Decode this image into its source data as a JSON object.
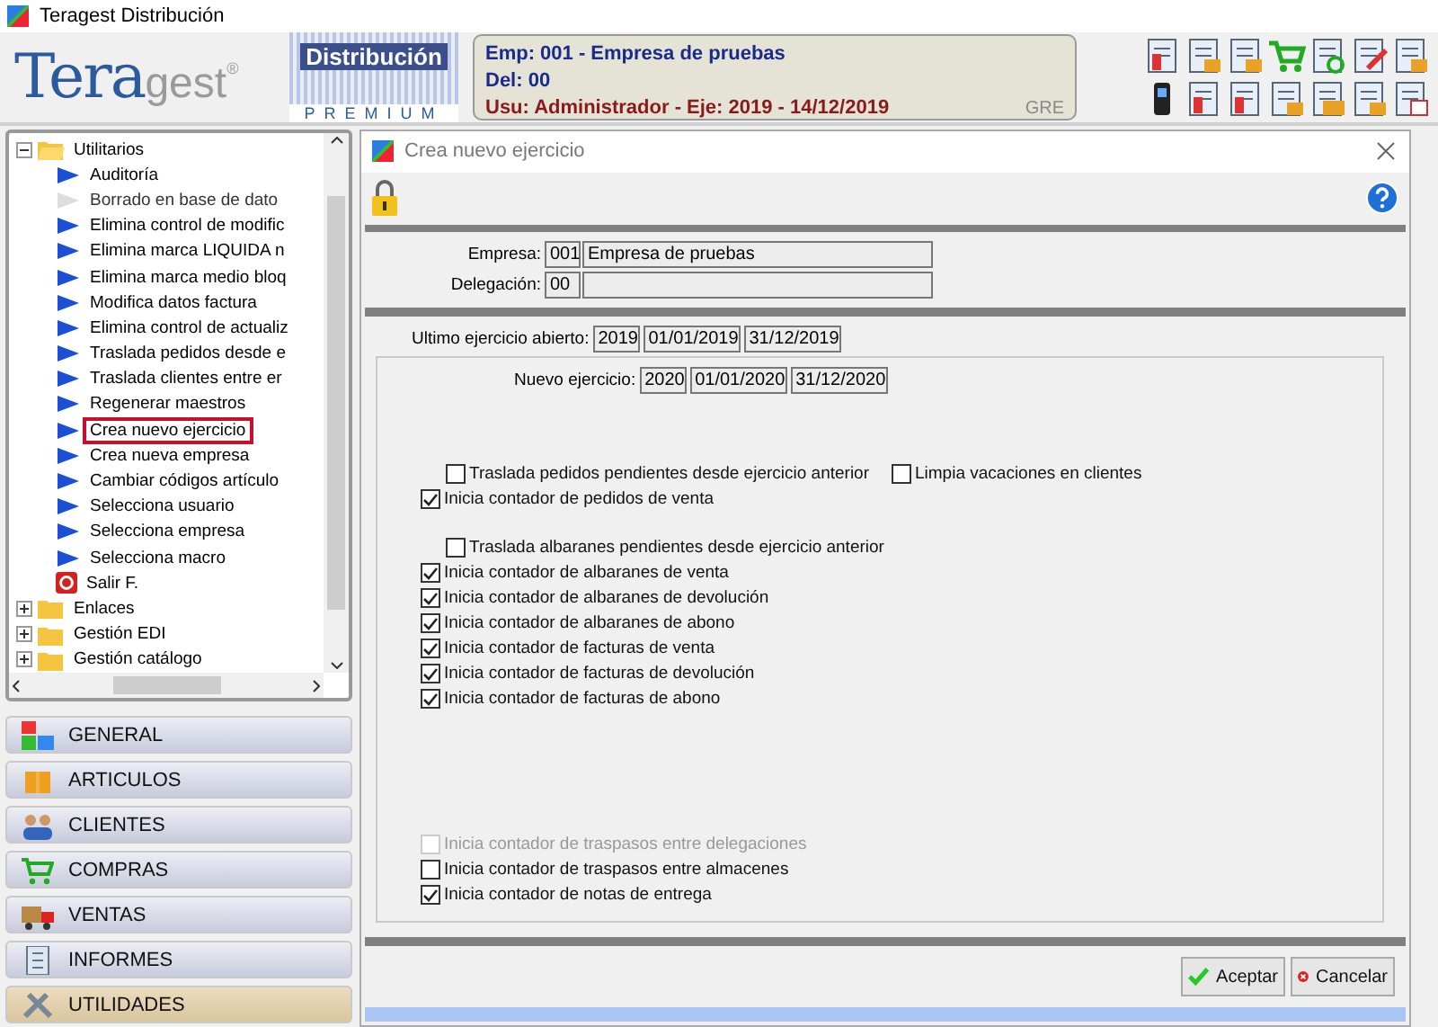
{
  "window": {
    "title": "Teragest Distribución"
  },
  "header": {
    "logo": {
      "part_1": "Tera",
      "part_2": "gest",
      "mark": "®"
    },
    "edition": {
      "name": "Distribución",
      "tier": "PREMIUM"
    },
    "info": {
      "company": "Emp: 001 - Empresa de pruebas",
      "branch": "Del:  00",
      "user": "Usu:  Administrador - Eje: 2019 - 14/12/2019",
      "code": "GRE"
    }
  },
  "tree": {
    "items": [
      {
        "label": "Utilitarios",
        "kind": "folder",
        "expanded": true,
        "children": [
          {
            "label": "Auditoría",
            "kind": "action",
            "disabled": false,
            "selected": false
          },
          {
            "label": "Borrado en base de dato",
            "kind": "action",
            "disabled": true,
            "selected": false
          },
          {
            "label": "Elimina control de modific",
            "kind": "action",
            "disabled": false,
            "selected": false
          },
          {
            "label": "Elimina marca LIQUIDA n",
            "kind": "action",
            "disabled": false,
            "selected": false
          },
          {
            "label": "Elimina marca medio bloq",
            "kind": "action",
            "disabled": false,
            "selected": false
          },
          {
            "label": "Modifica datos factura",
            "kind": "action",
            "disabled": false,
            "selected": false
          },
          {
            "label": "Elimina control de actualiz",
            "kind": "action",
            "disabled": false,
            "selected": false
          },
          {
            "label": "Traslada pedidos desde e",
            "kind": "action",
            "disabled": false,
            "selected": false
          },
          {
            "label": "Traslada clientes entre er",
            "kind": "action",
            "disabled": false,
            "selected": false
          },
          {
            "label": "Regenerar maestros",
            "kind": "action",
            "disabled": false,
            "selected": false
          },
          {
            "label": "Crea nuevo ejercicio",
            "kind": "action",
            "disabled": false,
            "selected": true
          },
          {
            "label": "Crea nueva empresa",
            "kind": "action",
            "disabled": false,
            "selected": false
          },
          {
            "label": "Cambiar códigos artículo",
            "kind": "action",
            "disabled": false,
            "selected": false
          },
          {
            "label": "Selecciona usuario",
            "kind": "action",
            "disabled": false,
            "selected": false
          },
          {
            "label": "Selecciona empresa",
            "kind": "action",
            "disabled": false,
            "selected": false
          },
          {
            "label": "Selecciona macro",
            "kind": "action",
            "disabled": false,
            "selected": false
          },
          {
            "label": "Salir F.",
            "kind": "exit",
            "disabled": false,
            "selected": false
          }
        ]
      },
      {
        "label": "Enlaces",
        "kind": "folder",
        "expanded": false
      },
      {
        "label": "Gestión EDI",
        "kind": "folder",
        "expanded": false
      },
      {
        "label": "Gestión catálogo",
        "kind": "folder",
        "expanded": false
      }
    ]
  },
  "modules": [
    {
      "label": "GENERAL",
      "kind": "general",
      "selected": false
    },
    {
      "label": "ARTICULOS",
      "kind": "items",
      "selected": false
    },
    {
      "label": "CLIENTES",
      "kind": "clients",
      "selected": false
    },
    {
      "label": "COMPRAS",
      "kind": "purchases",
      "selected": false
    },
    {
      "label": "VENTAS",
      "kind": "sales",
      "selected": false
    },
    {
      "label": "INFORMES",
      "kind": "reports",
      "selected": false
    },
    {
      "label": "UTILIDADES",
      "kind": "utilities",
      "selected": true
    }
  ],
  "dialog": {
    "title": "Crea nuevo ejercicio",
    "company": {
      "label": "Empresa:",
      "code": "001",
      "name": "Empresa de pruebas"
    },
    "branch": {
      "label": "Delegación:",
      "code": "00"
    },
    "last_year": {
      "label": "Ultimo ejercicio abierto:",
      "year": "2019",
      "start": "01/01/2019",
      "end": "31/12/2019"
    },
    "new_year": {
      "label": "Nuevo ejercicio:",
      "year": "2020",
      "start": "01/01/2020",
      "end": "31/12/2020"
    },
    "option_groups": [
      {
        "transfer_option": {
          "label": "Traslada pedidos pendientes desde ejercicio anterior",
          "checked": false,
          "disabled": false
        },
        "options": [
          {
            "label": "Inicia contador de pedidos de venta",
            "checked": true,
            "disabled": false
          }
        ],
        "side_options": [
          {
            "label": "Limpia vacaciones en clientes",
            "checked": false,
            "disabled": false
          }
        ]
      },
      {
        "transfer_option": {
          "label": "Traslada albaranes pendientes desde ejercicio anterior",
          "checked": false,
          "disabled": false
        },
        "options": [
          {
            "label": "Inicia contador de albaranes de venta",
            "checked": true,
            "disabled": false
          },
          {
            "label": "Inicia contador de albaranes de devolución",
            "checked": true,
            "disabled": false
          },
          {
            "label": "Inicia contador de albaranes de abono",
            "checked": true,
            "disabled": false
          },
          {
            "label": "Inicia contador de facturas de venta",
            "checked": true,
            "disabled": false
          },
          {
            "label": "Inicia contador de facturas de devolución",
            "checked": true,
            "disabled": false
          },
          {
            "label": "Inicia contador de facturas de abono",
            "checked": true,
            "disabled": false
          }
        ]
      },
      {
        "options": [
          {
            "label": "Inicia contador de traspasos entre delegaciones",
            "checked": false,
            "disabled": true
          },
          {
            "label": "Inicia contador de traspasos entre almacenes",
            "checked": false,
            "disabled": false
          },
          {
            "label": "Inicia contador de notas de entrega",
            "checked": true,
            "disabled": false
          }
        ]
      }
    ],
    "buttons": [
      {
        "label": "Aceptar",
        "kind": "ok"
      },
      {
        "label": "Cancelar",
        "kind": "cancel"
      }
    ]
  }
}
